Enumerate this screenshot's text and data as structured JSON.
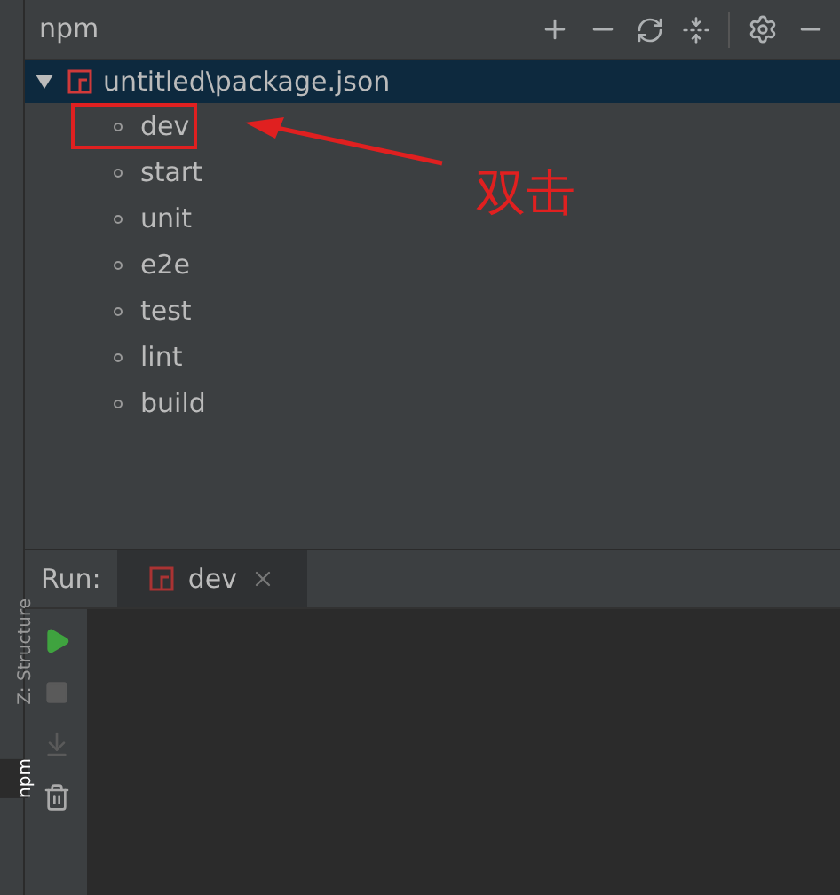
{
  "side_tabs": [
    {
      "label": "Z: Structure",
      "selected": false
    },
    {
      "label": "npm",
      "selected": true
    }
  ],
  "panel": {
    "title": "npm"
  },
  "tree": {
    "label": "untitled\\package.json",
    "expanded": true,
    "selected": true,
    "children": [
      {
        "label": "dev",
        "highlighted": true
      },
      {
        "label": "start",
        "highlighted": false
      },
      {
        "label": "unit",
        "highlighted": false
      },
      {
        "label": "e2e",
        "highlighted": false
      },
      {
        "label": "test",
        "highlighted": false
      },
      {
        "label": "lint",
        "highlighted": false
      },
      {
        "label": "build",
        "highlighted": false
      }
    ]
  },
  "annotation": {
    "text": "双击"
  },
  "run": {
    "label": "Run:",
    "tabs": [
      {
        "label": "dev",
        "selected": true
      }
    ]
  }
}
